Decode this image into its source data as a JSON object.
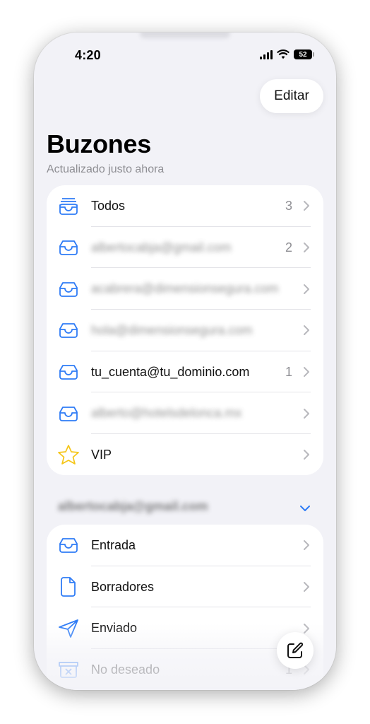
{
  "status_bar": {
    "time": "4:20",
    "battery": "52"
  },
  "header": {
    "edit_label": "Editar",
    "title": "Buzones",
    "subtitle": "Actualizado justo ahora"
  },
  "mailboxes": [
    {
      "label": "Todos",
      "count": "3",
      "icon": "inbox-stack-icon"
    },
    {
      "label": "albertocabja@gmail.com",
      "count": "2",
      "icon": "inbox-icon",
      "obscured": true
    },
    {
      "label": "acabrera@dimensionsegura.com",
      "count": "",
      "icon": "inbox-icon",
      "obscured": true
    },
    {
      "label": "hola@dimensionsegura.com",
      "count": "",
      "icon": "inbox-icon",
      "obscured": true
    },
    {
      "label": "tu_cuenta@tu_dominio.com",
      "count": "1",
      "icon": "inbox-icon"
    },
    {
      "label": "alberto@hotelsdelonca.mx",
      "count": "",
      "icon": "inbox-icon",
      "obscured": true
    },
    {
      "label": "VIP",
      "count": "",
      "icon": "star-icon"
    }
  ],
  "account_section": {
    "title": "albertocabja@gmail.com",
    "obscured": true,
    "folders": [
      {
        "label": "Entrada",
        "count": "",
        "icon": "inbox-icon"
      },
      {
        "label": "Borradores",
        "count": "",
        "icon": "document-icon"
      },
      {
        "label": "Enviado",
        "count": "",
        "icon": "paper-plane-icon"
      },
      {
        "label": "No deseado",
        "count": "1",
        "icon": "junk-icon"
      }
    ]
  },
  "colors": {
    "accent": "#2f7cf6",
    "star": "#f5c518",
    "background": "#f2f2f7",
    "secondary_text": "#8e8e93"
  }
}
